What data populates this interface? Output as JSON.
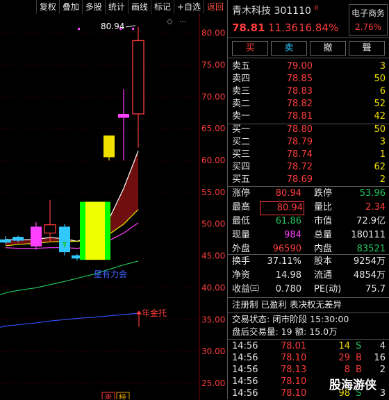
{
  "toolbar": {
    "items": [
      "复权",
      "叠加",
      "多股",
      "统计",
      "画线",
      "标记",
      "+自选",
      "返回"
    ]
  },
  "chart_data": {
    "type": "candlestick",
    "y_ticks": [
      "80.00",
      "75.00",
      "70.00",
      "65.00",
      "60.00",
      "55.00",
      "50.00",
      "45.00",
      "40.00",
      "35.00",
      "30.00",
      "25.00"
    ],
    "ylim": [
      22.5,
      83.0
    ],
    "candles": [
      {
        "open": 47.6,
        "close": 47.1,
        "high": 48.1,
        "low": 46.8,
        "color": "#30c8ff"
      },
      {
        "open": 48.0,
        "close": 47.4,
        "high": 48.2,
        "low": 47.1,
        "color": "#30c8ff"
      },
      {
        "open": 46.5,
        "close": 49.6,
        "high": 50.3,
        "low": 46.0,
        "color": "#ff40ff"
      },
      {
        "open": 48.6,
        "close": 49.9,
        "high": 53.8,
        "low": 47.2,
        "color": "#ff3c3c"
      },
      {
        "open": 49.6,
        "close": 45.6,
        "high": 50.0,
        "low": 45.1,
        "color": "#30c8ff"
      },
      {
        "open": 45.1,
        "close": 44.6,
        "high": 45.3,
        "low": 44.3,
        "color": "#30c8ff"
      },
      {
        "open": 44.4,
        "close": 53.5,
        "high": 53.5,
        "low": 44.4,
        "color": "#f0e000",
        "highlight": true
      },
      {
        "open": 60.5,
        "close": 63.9,
        "high": 63.9,
        "low": 60.0,
        "color": "#f0e000"
      },
      {
        "open": 66.7,
        "close": 67.3,
        "high": 71.2,
        "low": 60.0,
        "color": "#ff40ff"
      },
      {
        "open": 67.3,
        "close": 78.81,
        "high": 80.94,
        "low": 62.0,
        "color": "#ff3c3c"
      }
    ],
    "annotations": {
      "high_label": "80.94",
      "bottom_label": "星有力会",
      "support_label": "年金托",
      "badge_zhang": "涨",
      "badge_bang": "榜"
    }
  },
  "quote": {
    "name": "青木科技",
    "code": "301110",
    "reg_mark": "R",
    "price": "78.81",
    "change": "11.36",
    "change_pct": "16.84%",
    "sector_label": "电子商务",
    "sector_pct": "2.76%",
    "buttons": [
      "买",
      "卖",
      "撤",
      "聲"
    ],
    "asks": [
      {
        "label": "卖五",
        "price": "79.00",
        "vol": "3"
      },
      {
        "label": "卖四",
        "price": "78.85",
        "vol": "50"
      },
      {
        "label": "卖三",
        "price": "78.83",
        "vol": "6"
      },
      {
        "label": "卖二",
        "price": "78.82",
        "vol": "52"
      },
      {
        "label": "卖一",
        "price": "78.81",
        "vol": "42"
      }
    ],
    "bids": [
      {
        "label": "买一",
        "price": "78.80",
        "vol": "50"
      },
      {
        "label": "买二",
        "price": "78.79",
        "vol": "3"
      },
      {
        "label": "买三",
        "price": "78.74",
        "vol": "1"
      },
      {
        "label": "买四",
        "price": "78.72",
        "vol": "62"
      },
      {
        "label": "买五",
        "price": "78.69",
        "vol": "2"
      }
    ],
    "stats": [
      {
        "l1": "涨停",
        "v1": "80.94",
        "l2": "跌停",
        "v2": "53.96"
      },
      {
        "l1": "最高",
        "v1": "80.94",
        "l2": "量比",
        "v2": "2.34"
      },
      {
        "l1": "最低",
        "v1": "61.86",
        "l2": "市值",
        "v2": "72.9亿"
      },
      {
        "l1": "现量",
        "v1": "984",
        "l2": "总量",
        "v2": "180111"
      },
      {
        "l1": "外盘",
        "v1": "96590",
        "l2": "内盘",
        "v2": "83521"
      }
    ],
    "stats2": [
      {
        "l1": "换手",
        "v1": "37.11%",
        "l2": "股本",
        "v2": "9254万"
      },
      {
        "l1": "净资",
        "v1": "14.98",
        "l2": "流通",
        "v2": "4854万"
      },
      {
        "l1": "收益㈢",
        "v1": "0.780",
        "l2": "PE(动)",
        "v2": "75.7"
      }
    ],
    "info_line": "注册制 已盈利 表决权无差异",
    "status_line": "交易状态: 闭市阶段 15:30:00",
    "after_line": "盘后交易量: 19  额: 15.0万",
    "ticks": [
      {
        "time": "14:56",
        "price": "78.01",
        "vol": "14",
        "side": "S",
        "n": "4"
      },
      {
        "time": "14:56",
        "price": "78.10",
        "vol": "29",
        "side": "B",
        "n": "16"
      },
      {
        "time": "14:56",
        "price": "78.13",
        "vol": "8",
        "side": "B",
        "n": "2"
      },
      {
        "time": "14:56",
        "price": "78.10",
        "vol": "",
        "side": "",
        "n": ""
      },
      {
        "time": "14:56",
        "price": "78.10",
        "vol": "98",
        "side": "S",
        "n": "3"
      }
    ],
    "watermark": "股海游侠"
  }
}
